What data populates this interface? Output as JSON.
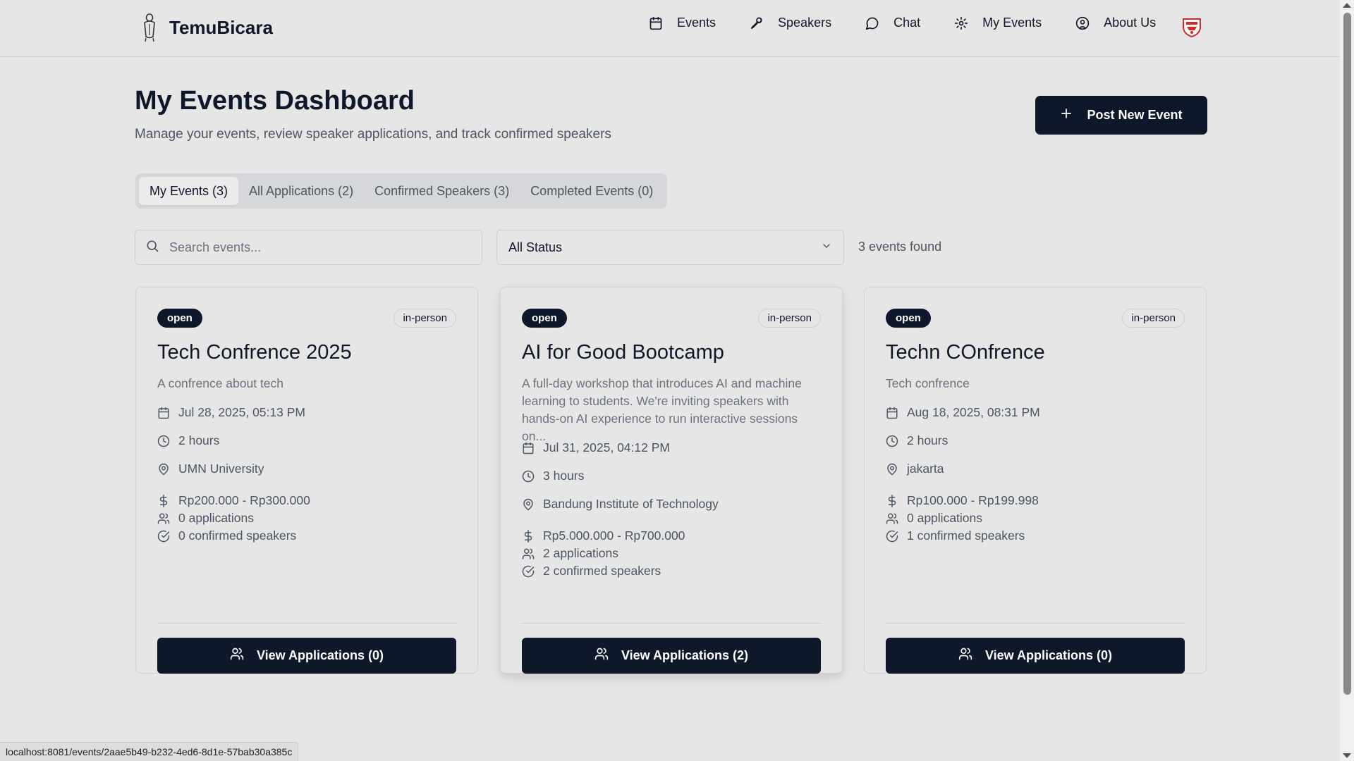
{
  "app": {
    "name": "TemuBicara"
  },
  "nav": {
    "links": [
      {
        "label": "Events",
        "icon": "calendar-icon"
      },
      {
        "label": "Speakers",
        "icon": "mic-icon"
      },
      {
        "label": "Chat",
        "icon": "chat-icon"
      },
      {
        "label": "My Events",
        "icon": "gear-icon"
      },
      {
        "label": "About Us",
        "icon": "user-circle-icon"
      }
    ]
  },
  "header": {
    "title": "My Events Dashboard",
    "subtitle": "Manage your events, review speaker applications, and track confirmed speakers",
    "post_button": "Post New Event"
  },
  "tabs": [
    {
      "label": "My Events (3)",
      "active": true
    },
    {
      "label": "All Applications (2)",
      "active": false
    },
    {
      "label": "Confirmed Speakers (3)",
      "active": false
    },
    {
      "label": "Completed Events (0)",
      "active": false
    }
  ],
  "filters": {
    "search_placeholder": "Search events...",
    "status_selected": "All Status",
    "result_count": "3 events found"
  },
  "events": [
    {
      "status": "open",
      "type": "in-person",
      "title": "Tech Confrence 2025",
      "description": "A confrence about tech",
      "date": "Jul 28, 2025, 05:13 PM",
      "duration": "2 hours",
      "location": "UMN University",
      "fee": "Rp200.000 - Rp300.000",
      "applications": "0 applications",
      "confirmed": "0 confirmed speakers",
      "button": "View Applications (0)"
    },
    {
      "status": "open",
      "type": "in-person",
      "title": "AI for Good Bootcamp",
      "description": "A full-day workshop that introduces AI and machine learning to students. We're inviting speakers with hands-on AI experience to run interactive sessions on...",
      "date": "Jul 31, 2025, 04:12 PM",
      "duration": "3 hours",
      "location": "Bandung Institute of Technology",
      "fee": "Rp5.000.000 - Rp700.000",
      "applications": "2 applications",
      "confirmed": "2 confirmed speakers",
      "button": "View Applications (2)"
    },
    {
      "status": "open",
      "type": "in-person",
      "title": "Techn COnfrence",
      "description": "Tech confrence",
      "date": "Aug 18, 2025, 08:31 PM",
      "duration": "2 hours",
      "location": "jakarta",
      "fee": "Rp100.000 - Rp199.998",
      "applications": "0 applications",
      "confirmed": "1 confirmed speakers",
      "button": "View Applications (0)"
    }
  ],
  "status_bar": {
    "url": "localhost:8081/events/2aae5b49-b232-4ed6-8d1e-57bab30a385c"
  },
  "colors": {
    "primary": "#0f172a",
    "background": "#e6e6e6",
    "muted_text": "#6b7280"
  }
}
